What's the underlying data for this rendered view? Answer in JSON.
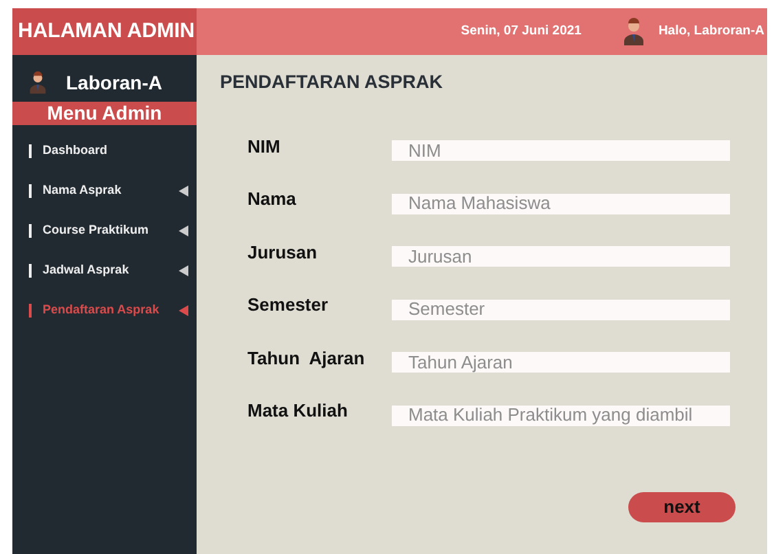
{
  "header": {
    "title": "HALAMAN ADMIN",
    "date": "Senin, 07 Juni 2021",
    "greeting": "Halo, Labroran-A"
  },
  "sidebar": {
    "user": "Laboran-A",
    "section": "Menu Admin",
    "items": [
      {
        "label": "Dashboard",
        "submenu": false,
        "selected": false
      },
      {
        "label": "Nama Asprak",
        "submenu": true,
        "selected": false
      },
      {
        "label": "Course Praktikum",
        "submenu": true,
        "selected": false
      },
      {
        "label": "Jadwal Asprak",
        "submenu": true,
        "selected": false
      },
      {
        "label": "Pendaftaran Asprak",
        "submenu": true,
        "selected": true
      }
    ]
  },
  "form": {
    "title": "PENDAFTARAN ASPRAK",
    "fields": [
      {
        "label": "NIM",
        "placeholder": "NIM"
      },
      {
        "label": "Nama",
        "placeholder": "Nama Mahasiswa"
      },
      {
        "label": "Jurusan",
        "placeholder": "Jurusan"
      },
      {
        "label": "Semester",
        "placeholder": "Semester"
      },
      {
        "label": "Tahun  Ajaran",
        "placeholder": "Tahun Ajaran"
      },
      {
        "label": "Mata Kuliah",
        "placeholder": "Mata Kuliah Praktikum yang diambil"
      }
    ],
    "button": "next"
  }
}
